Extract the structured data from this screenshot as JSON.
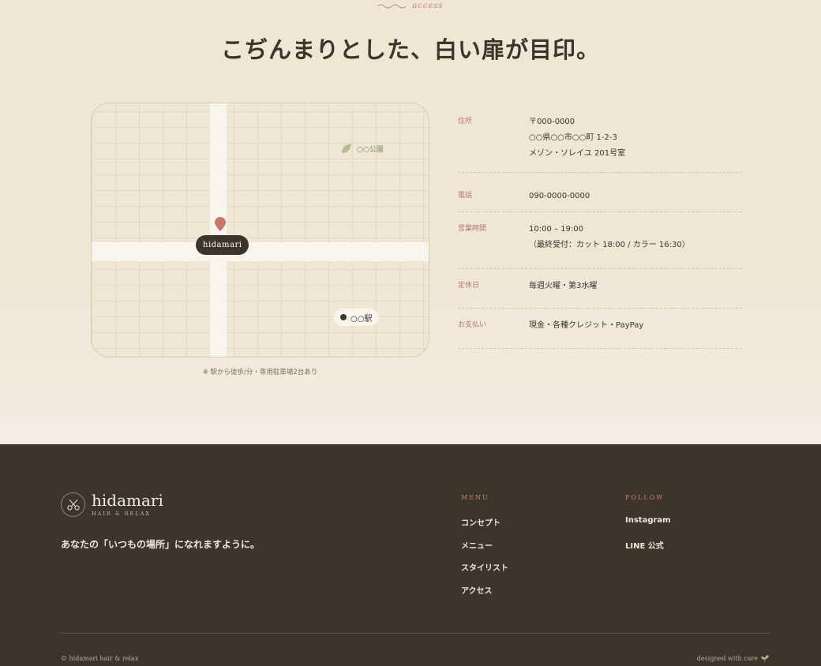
{
  "access": {
    "eyebrow": "access",
    "title": "こぢんまりとした、白い扉が目印。",
    "map": {
      "shop_label": "hidamari",
      "park_label": "○○公園",
      "station_label": "○○駅"
    },
    "note": "※ 駅から徒歩/分・専用駐車場2台あり",
    "info": [
      {
        "label": "住所",
        "lines": [
          "〒000-0000",
          "○○県○○市○○町 1-2-3",
          "メゾン・ソレイユ 201号室"
        ]
      },
      {
        "label": "電話",
        "lines": [
          "090-0000-0000"
        ]
      },
      {
        "label": "営業時間",
        "lines": [
          "10:00 – 19:00",
          "（最終受付：カット 18:00 / カラー 16:30）"
        ]
      },
      {
        "label": "定休日",
        "lines": [
          "毎週火曜・第3水曜"
        ]
      },
      {
        "label": "お支払い",
        "lines": [
          "現金・各種クレジット・PayPay"
        ]
      }
    ]
  },
  "footer": {
    "logo_name": "hidamari",
    "logo_sub": "HAIR & RELAX",
    "tagline": "あなたの「いつもの場所」になれますように。",
    "menu": {
      "title": "MENU",
      "items": [
        "コンセプト",
        "メニュー",
        "スタイリスト",
        "アクセス"
      ]
    },
    "follow": {
      "title": "FOLLOW",
      "items": [
        "Instagram",
        "LINE 公式"
      ]
    },
    "copyright": "© hidamari hair & relax",
    "credit": "designed with care"
  },
  "colors": {
    "accent": "#b5796a",
    "dark": "#3d342a",
    "cream": "#efe6d5",
    "leaf": "#a9b58a"
  }
}
